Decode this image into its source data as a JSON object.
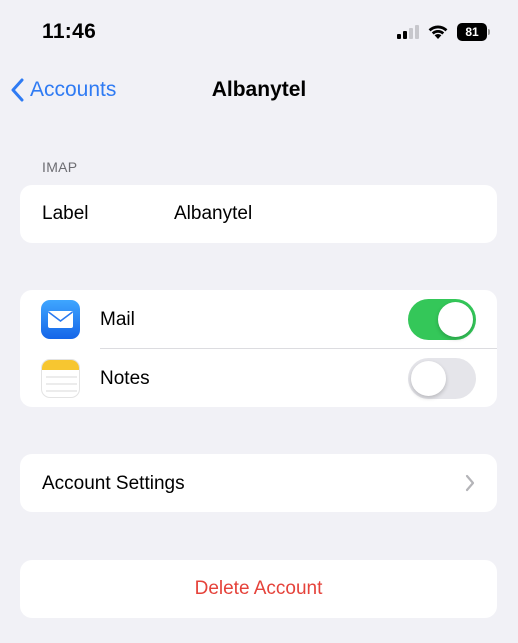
{
  "status_bar": {
    "time": "11:46",
    "battery": "81"
  },
  "nav": {
    "back_label": "Accounts",
    "title": "Albanytel"
  },
  "section_header": "IMAP",
  "label_row": {
    "key": "Label",
    "value": "Albanytel"
  },
  "toggles": [
    {
      "label": "Mail",
      "on": true,
      "icon": "mail-icon"
    },
    {
      "label": "Notes",
      "on": false,
      "icon": "notes-icon"
    }
  ],
  "account_settings": {
    "label": "Account Settings"
  },
  "delete_account": {
    "label": "Delete Account"
  },
  "colors": {
    "accent": "#2f7bf3",
    "toggle_on": "#34c759",
    "destructive": "#e5423a",
    "background": "#f1f1f6"
  }
}
